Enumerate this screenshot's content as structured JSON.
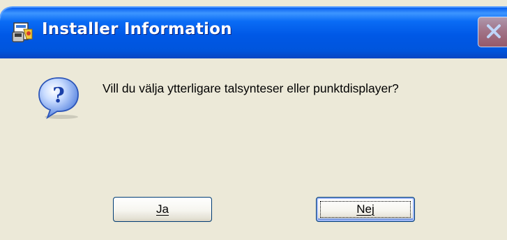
{
  "window": {
    "title": "Installer Information",
    "icon": "installer-icon",
    "close_icon": "close-icon"
  },
  "dialog": {
    "icon": "question-icon",
    "message": "Vill du välja ytterligare talsynteser eller punktdisplayer?"
  },
  "buttons": {
    "yes_label": "Ja",
    "no_label": "Nej",
    "default_button": "Nej"
  },
  "colors": {
    "titlebar": "#0a5ddd",
    "titlebar_dark": "#0845c6",
    "face": "#ece9d8",
    "button_border": "#003c74"
  }
}
